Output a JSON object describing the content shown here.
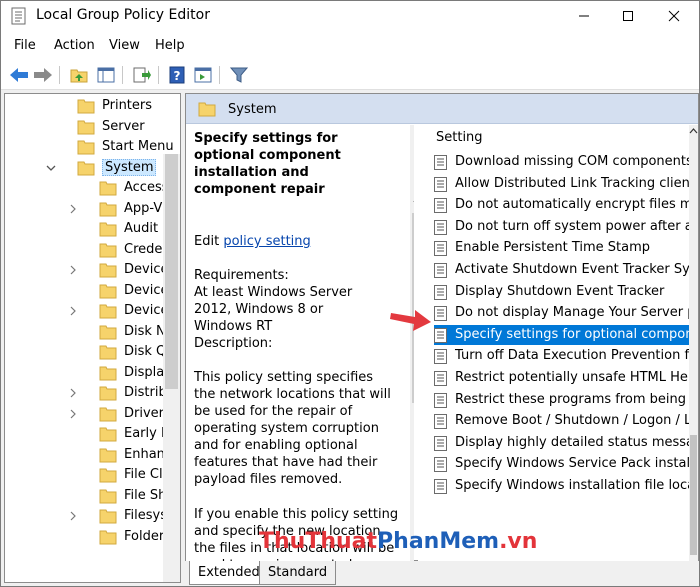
{
  "window": {
    "title": "Local Group Policy Editor"
  },
  "menu": [
    "File",
    "Action",
    "View",
    "Help"
  ],
  "tree": {
    "items": [
      {
        "label": "Printers",
        "level": 1,
        "expand": ""
      },
      {
        "label": "Server",
        "level": 1,
        "expand": ""
      },
      {
        "label": "Start Menu",
        "level": 1,
        "expand": ""
      },
      {
        "label": "System",
        "level": 1,
        "expand": "open",
        "selected": true
      },
      {
        "label": "Access-",
        "level": 2,
        "expand": ""
      },
      {
        "label": "App-V",
        "level": 2,
        "expand": "closed"
      },
      {
        "label": "Audit P",
        "level": 2,
        "expand": ""
      },
      {
        "label": "Creden",
        "level": 2,
        "expand": ""
      },
      {
        "label": "Device",
        "level": 2,
        "expand": "closed"
      },
      {
        "label": "Device",
        "level": 2,
        "expand": ""
      },
      {
        "label": "Device",
        "level": 2,
        "expand": "closed"
      },
      {
        "label": "Disk N",
        "level": 2,
        "expand": ""
      },
      {
        "label": "Disk Q",
        "level": 2,
        "expand": ""
      },
      {
        "label": "Display",
        "level": 2,
        "expand": ""
      },
      {
        "label": "Distrib",
        "level": 2,
        "expand": "closed"
      },
      {
        "label": "Driver",
        "level": 2,
        "expand": "closed"
      },
      {
        "label": "Early La",
        "level": 2,
        "expand": ""
      },
      {
        "label": "Enhanc",
        "level": 2,
        "expand": ""
      },
      {
        "label": "File Cla",
        "level": 2,
        "expand": ""
      },
      {
        "label": "File Sh",
        "level": 2,
        "expand": ""
      },
      {
        "label": "Filesys",
        "level": 2,
        "expand": "closed"
      },
      {
        "label": "Folder",
        "level": 2,
        "expand": ""
      }
    ]
  },
  "right": {
    "header": "System",
    "description": {
      "title": "Specify settings for optional component installation and component repair",
      "edit_prefix": "Edit ",
      "edit_link": "policy setting",
      "requirements_label": "Requirements:",
      "requirements_text": "At least Windows Server 2012, Windows 8 or Windows RT",
      "description_label": "Description:",
      "para1": "This policy setting specifies the network locations that will be used for the repair of operating system corruption and for enabling optional features that have had their payload files removed.",
      "para2": "If you enable this policy setting and specify the new location, the files in that location will be used to repair corrupted system"
    },
    "list": {
      "header": "Setting",
      "items": [
        "Download missing COM components",
        "Allow Distributed Link Tracking clients to",
        "Do not automatically encrypt files move",
        "Do not turn off system power after a W",
        "Enable Persistent Time Stamp",
        "Activate Shutdown Event Tracker System",
        "Display Shutdown Event Tracker",
        "Do not display Manage Your Server pag",
        "Specify settings for optional componen",
        "Turn off Data Execution Prevention for E",
        "Restrict potentially unsafe HTML Help fu",
        "Restrict these programs from being laun",
        "Remove Boot / Shutdown / Logon / Log",
        "Display highly detailed status messages",
        "Specify Windows Service Pack installatio",
        "Specify Windows installation file locatio"
      ],
      "selected_index": 8
    }
  },
  "tabs": [
    "Extended",
    "Standard"
  ],
  "watermark": {
    "part1": "ThuThuat",
    "part2": "PhanMem",
    "part3": ".vn"
  },
  "colors": {
    "selection": "#0078d7",
    "header_bg": "#d4dff0",
    "folder": "#f6d36b",
    "link": "#0645ad"
  }
}
